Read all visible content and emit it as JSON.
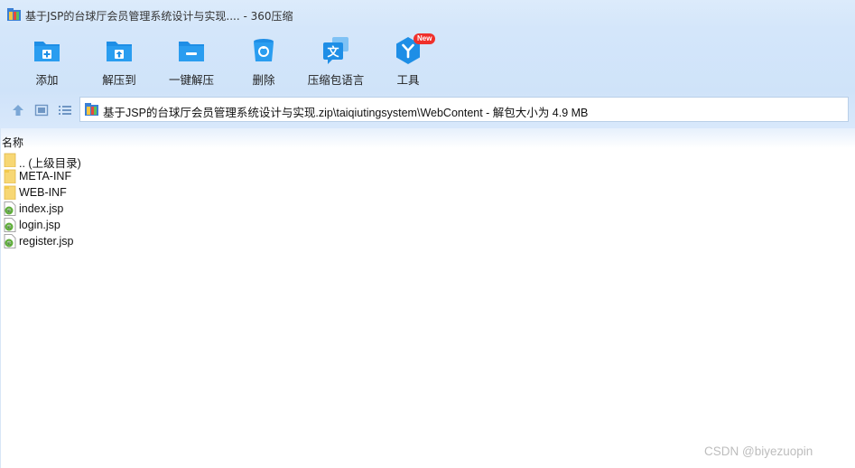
{
  "window": {
    "title": "基于JSP的台球厅会员管理系统设计与实现.... - 360压缩"
  },
  "toolbar": {
    "items": [
      {
        "label": "添加",
        "icon": "add-folder-icon"
      },
      {
        "label": "解压到",
        "icon": "extract-to-icon"
      },
      {
        "label": "一键解压",
        "icon": "one-click-extract-icon"
      },
      {
        "label": "删除",
        "icon": "trash-icon"
      },
      {
        "label": "压缩包语言",
        "icon": "language-icon"
      },
      {
        "label": "工具",
        "icon": "tools-icon",
        "badge": "New"
      }
    ]
  },
  "addressbar": {
    "path": "基于JSP的台球厅会员管理系统设计与实现.zip\\taiqiutingsystem\\WebContent - 解包大小为 4.9 MB"
  },
  "filelist": {
    "column_name": "名称",
    "items": [
      {
        "name": ".. (上级目录)",
        "type": "folder-up"
      },
      {
        "name": "META-INF",
        "type": "folder"
      },
      {
        "name": "WEB-INF",
        "type": "folder"
      },
      {
        "name": "index.jsp",
        "type": "jsp"
      },
      {
        "name": "login.jsp",
        "type": "jsp"
      },
      {
        "name": "register.jsp",
        "type": "jsp"
      }
    ]
  },
  "watermark": "CSDN @biyezuopin",
  "colors": {
    "accent": "#1e8ee6",
    "toolbar_bg": "#d4e6fa",
    "badge": "#f0302b"
  }
}
